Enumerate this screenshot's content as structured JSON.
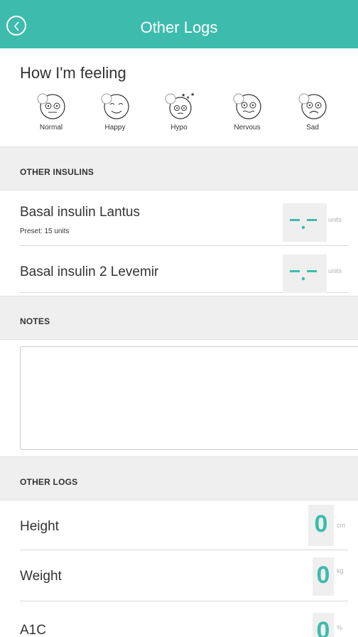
{
  "header": {
    "title": "Other Logs"
  },
  "feeling": {
    "title": "How I'm feeling",
    "moods": [
      {
        "label": "Normal",
        "icon": "normal-face-icon"
      },
      {
        "label": "Happy",
        "icon": "happy-face-icon"
      },
      {
        "label": "Hypo",
        "icon": "hypo-face-icon"
      },
      {
        "label": "Nervous",
        "icon": "nervous-face-icon"
      },
      {
        "label": "Sad",
        "icon": "sad-face-icon"
      }
    ]
  },
  "insulins": {
    "heading": "OTHER INSULINS",
    "items": [
      {
        "label": "Basal insulin Lantus",
        "sub": "Preset: 15 units",
        "unit": "units"
      },
      {
        "label": "Basal insulin 2 Levemir",
        "unit": "units"
      }
    ]
  },
  "notes": {
    "heading": "NOTES",
    "value": ""
  },
  "other_logs": {
    "heading": "OTHER LOGS",
    "items": [
      {
        "label": "Height",
        "value": "0",
        "unit": "cm"
      },
      {
        "label": "Weight",
        "value": "0",
        "unit": "kg"
      },
      {
        "label": "A1C",
        "value": "0",
        "unit": "%"
      }
    ]
  },
  "colors": {
    "accent": "#3dbcad",
    "section_bg": "#efefef"
  }
}
